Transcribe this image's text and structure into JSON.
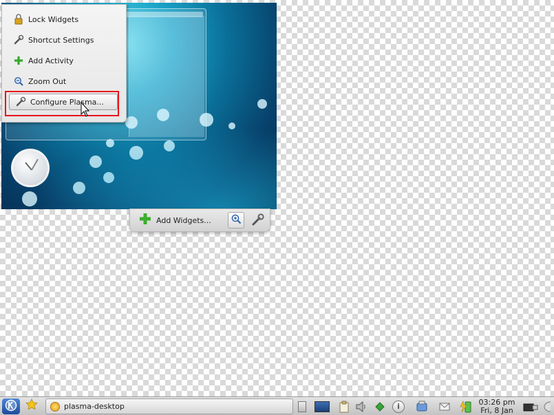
{
  "context_menu": {
    "items": [
      {
        "label": "Lock Widgets",
        "icon": "lock-icon"
      },
      {
        "label": "Shortcut Settings",
        "icon": "wrench-icon"
      },
      {
        "label": "Add Activity",
        "icon": "plus-icon"
      },
      {
        "label": "Zoom Out",
        "icon": "zoom-out-icon"
      },
      {
        "label": "Configure Plasma...",
        "icon": "configure-wrench-icon"
      }
    ]
  },
  "toolbox": {
    "add_widgets_label": "Add Widgets...",
    "zoom_icon": "zoom-in-icon",
    "configure_icon": "wrench-icon"
  },
  "taskbar": {
    "task_label": "plasma-desktop",
    "clock_time": "03:26 pm",
    "clock_date": "Fri, 8 Jan"
  },
  "colors": {
    "highlight": "#e8141c",
    "desktop_accent": "#1aa4c8",
    "add_green": "#3cae2c"
  }
}
